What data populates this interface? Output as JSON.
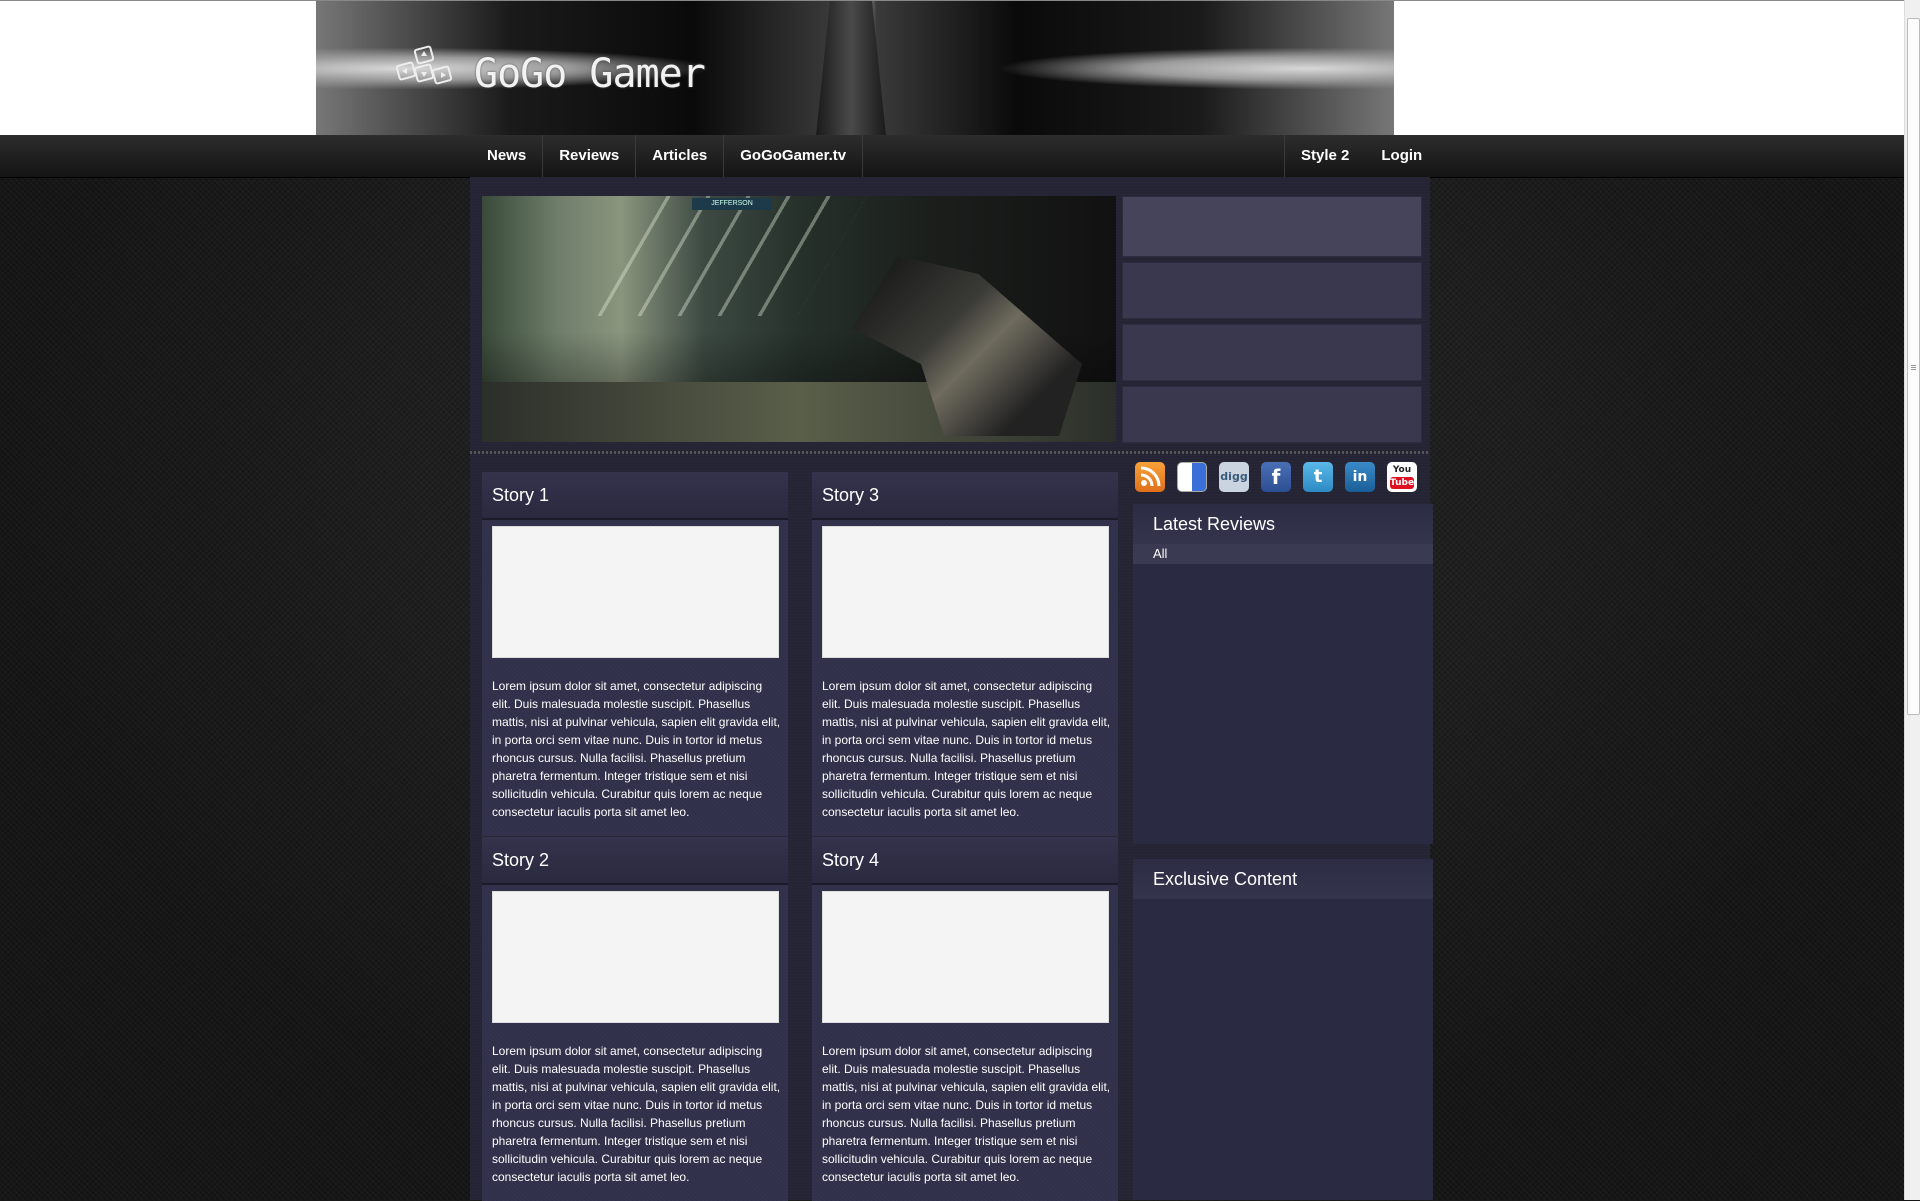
{
  "site": {
    "logo_text": "GoGo Gamer"
  },
  "nav": {
    "left": [
      "News",
      "Reviews",
      "Articles",
      "GoGoGamer.tv"
    ],
    "right": [
      "Style 2",
      "Login"
    ]
  },
  "featured": {
    "sign_text": "JEFFERSON"
  },
  "stories": [
    {
      "title": "Story 1",
      "text": "Lorem ipsum dolor sit amet, consectetur adipiscing elit. Duis malesuada molestie suscipit. Phasellus mattis, nisi at pulvinar vehicula, sapien elit gravida elit, in porta orci sem vitae nunc. Duis in tortor id metus rhoncus cursus. Nulla facilisi. Phasellus pretium pharetra fermentum. Integer tristique sem et nisi sollicitudin vehicula. Curabitur quis lorem ac neque consectetur iaculis porta sit amet leo."
    },
    {
      "title": "Story 3",
      "text": "Lorem ipsum dolor sit amet, consectetur adipiscing elit. Duis malesuada molestie suscipit. Phasellus mattis, nisi at pulvinar vehicula, sapien elit gravida elit, in porta orci sem vitae nunc. Duis in tortor id metus rhoncus cursus. Nulla facilisi. Phasellus pretium pharetra fermentum. Integer tristique sem et nisi sollicitudin vehicula. Curabitur quis lorem ac neque consectetur iaculis porta sit amet leo."
    },
    {
      "title": "Story 2",
      "text": "Lorem ipsum dolor sit amet, consectetur adipiscing elit. Duis malesuada molestie suscipit. Phasellus mattis, nisi at pulvinar vehicula, sapien elit gravida elit, in porta orci sem vitae nunc. Duis in tortor id metus rhoncus cursus. Nulla facilisi. Phasellus pretium pharetra fermentum. Integer tristique sem et nisi sollicitudin vehicula. Curabitur quis lorem ac neque consectetur iaculis porta sit amet leo."
    },
    {
      "title": "Story 4",
      "text": "Lorem ipsum dolor sit amet, consectetur adipiscing elit. Duis malesuada molestie suscipit. Phasellus mattis, nisi at pulvinar vehicula, sapien elit gravida elit, in porta orci sem vitae nunc. Duis in tortor id metus rhoncus cursus. Nulla facilisi. Phasellus pretium pharetra fermentum. Integer tristique sem et nisi sollicitudin vehicula. Curabitur quis lorem ac neque consectetur iaculis porta sit amet leo."
    }
  ],
  "social": {
    "icons": [
      "rss-icon",
      "delicious-icon",
      "digg-icon",
      "facebook-icon",
      "twitter-icon",
      "linkedin-icon",
      "youtube-icon"
    ],
    "fb_glyph": "f",
    "tw_glyph": "t",
    "li_glyph": "in",
    "digg_glyph": "digg",
    "yt_you": "You",
    "yt_tube": "Tube"
  },
  "sidebar": {
    "latest_reviews": {
      "title": "Latest Reviews",
      "tab": "All"
    },
    "exclusive": {
      "title": "Exclusive Content"
    }
  },
  "colors": {
    "page_bg": "#252435",
    "story_bg": "#30304a",
    "featured_item": "#3a384e",
    "nav_bg": "#1e1e1e"
  }
}
